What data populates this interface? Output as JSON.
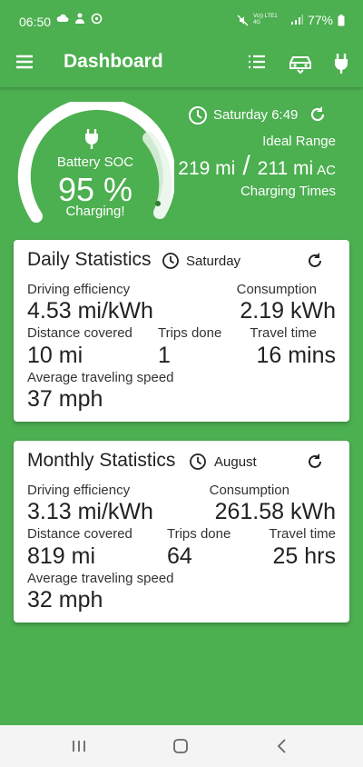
{
  "status": {
    "time": "06:50",
    "battery": "77%",
    "network": "Vo)) LTE1 4G"
  },
  "app": {
    "title": "Dashboard"
  },
  "hero": {
    "label": "Battery SOC",
    "soc": "95 %",
    "soc_level": 0.95,
    "state": "Charging!",
    "timestamp": "Saturday 6:49",
    "range_title": "Ideal Range",
    "range_a": "219 mi",
    "separator": "/",
    "range_b": "211 mi",
    "range_suffix": "AC",
    "charging_times": "Charging Times"
  },
  "daily": {
    "title": "Daily Statistics",
    "day": "Saturday",
    "labels": {
      "efficiency": "Driving efficiency",
      "consumption": "Consumption",
      "distance": "Distance covered",
      "trips": "Trips done",
      "travel_time": "Travel time",
      "avg_speed": "Average traveling speed"
    },
    "values": {
      "efficiency": "4.53 mi/kWh",
      "consumption": "2.19 kWh",
      "distance": "10 mi",
      "trips": "1",
      "travel_time": "16 mins",
      "avg_speed": "37 mph"
    }
  },
  "monthly": {
    "title": "Monthly Statistics",
    "month": "August",
    "labels": {
      "efficiency": "Driving efficiency",
      "consumption": "Consumption",
      "distance": "Distance covered",
      "trips": "Trips done",
      "travel_time": "Travel time",
      "avg_speed": "Average traveling speed"
    },
    "values": {
      "efficiency": "3.13 mi/kWh",
      "consumption": "261.58 kWh",
      "distance": "819 mi",
      "trips": "64",
      "travel_time": "25 hrs",
      "avg_speed": "32 mph"
    }
  },
  "colors": {
    "primary": "#4caf50",
    "card": "#ffffff",
    "text": "#222222"
  },
  "icons": {
    "appbar": [
      "menu-icon",
      "list-icon",
      "car-icon",
      "plug-icon"
    ],
    "hero": [
      "clock-icon",
      "refresh-icon",
      "plug-icon"
    ],
    "navbar": [
      "recent-apps-icon",
      "home-icon",
      "back-icon"
    ]
  }
}
